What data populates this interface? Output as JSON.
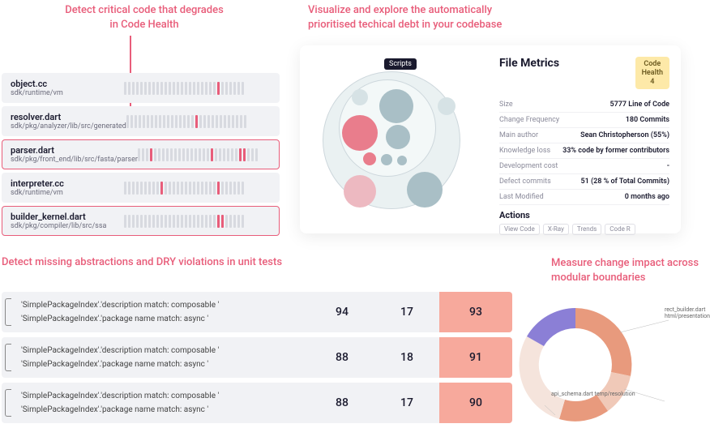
{
  "headlines": {
    "topLeftLine1": "Detect critical code that degrades",
    "topLeftLine2": "in Code Health",
    "topRightLine1": "Visualize and explore the automatically",
    "topRightLine2": "prioritised techical debt in your codebase",
    "bottomLeft": "Detect missing abstractions and DRY violations in unit tests",
    "bottomRightLine1": "Measure change impact across",
    "bottomRightLine2": "modular boundaries"
  },
  "files": [
    {
      "name": "object.cc",
      "path": "sdk/runtime/vm",
      "hits": [
        23
      ]
    },
    {
      "name": "resolver.dart",
      "path": "sdk/pkg/analyzer/lib/src/generated",
      "hits": [
        17
      ]
    },
    {
      "name": "parser.dart",
      "path": "sdk/pkg/front_end/lib/src/fasta/parser",
      "hits": [
        3,
        18,
        25,
        26
      ],
      "highlight": true
    },
    {
      "name": "interpreter.cc",
      "path": "sdk/runtime/vm",
      "hits": [
        9,
        23
      ]
    },
    {
      "name": "builder_kernel.dart",
      "path": "sdk/pkg/compiler/lib/src/ssa",
      "hits": [
        23,
        24
      ],
      "highlight": true
    }
  ],
  "panel": {
    "tag": "Scripts",
    "title": "File Metrics",
    "badge": {
      "t1": "Code",
      "t2": "Health",
      "t3": "4"
    },
    "metrics": [
      {
        "k": "Size",
        "v": "5777 Line of Code"
      },
      {
        "k": "Change Frequency",
        "v": "180 Commits"
      },
      {
        "k": "Main author",
        "v": "Sean Christopherson (55%)"
      },
      {
        "k": "Knowledge loss",
        "v": "33% code by former contributors"
      },
      {
        "k": "Development cost",
        "v": "-"
      },
      {
        "k": "Defect commits",
        "v": "51 (28 % of Total Commits)"
      },
      {
        "k": "Last Modified",
        "v": "0 months ago"
      }
    ],
    "actionsTitle": "Actions",
    "actions": [
      "View Code",
      "X-Ray",
      "Trends",
      "Code R"
    ]
  },
  "dry": [
    {
      "a": "'SimplePackageIndex'.'description match: composable '",
      "b": "'SimplePackageIndex'.'package name match: async '",
      "c1": "94",
      "c2": "17",
      "c3": "93"
    },
    {
      "a": "'SimplePackageIndex'.'description match: composable '",
      "b": "'SimplePackageIndex'.'package name match: async '",
      "c1": "88",
      "c2": "18",
      "c3": "91"
    },
    {
      "a": "'SimplePackageIndex'.'description match: composable '",
      "b": "'SimplePackageIndex'.'package name match: async '",
      "c1": "88",
      "c2": "17",
      "c3": "90"
    }
  ],
  "sunLabels": {
    "a": "rect_builder.dart\nhtml/presentation",
    "b": "api_schema.dart\ntemp/resolution"
  }
}
